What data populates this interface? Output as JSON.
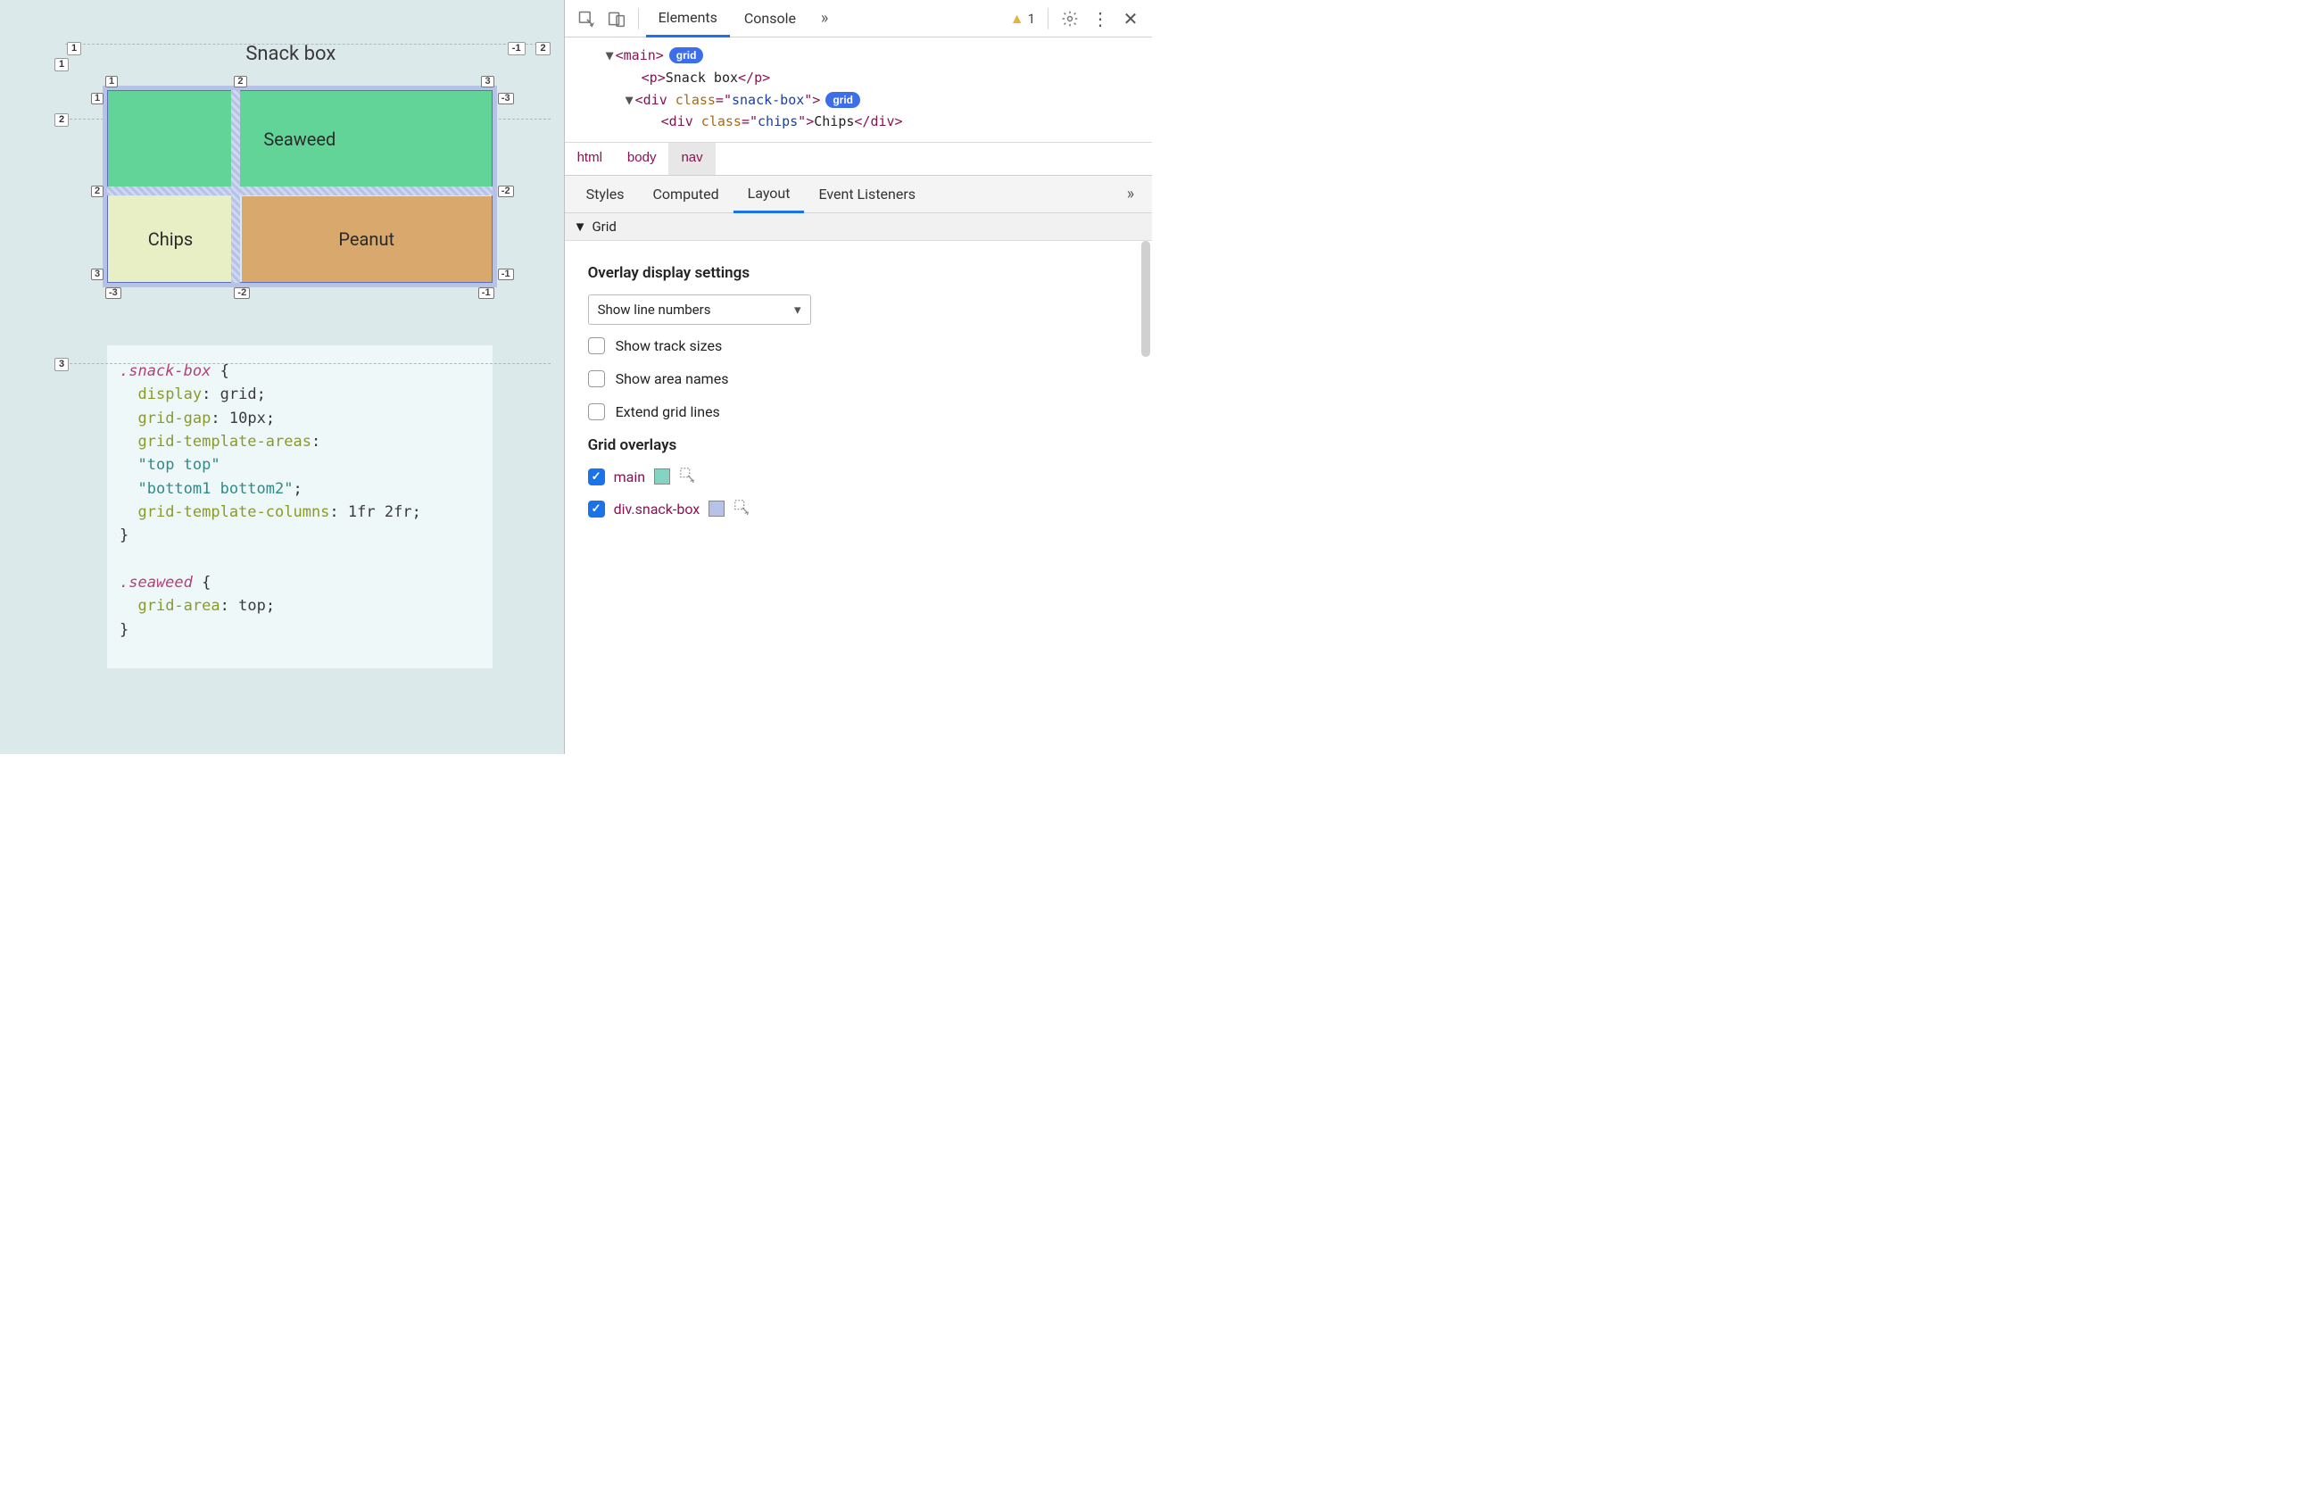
{
  "page": {
    "title": "Snack box",
    "snack_grid": {
      "seaweed": "Seaweed",
      "chips": "Chips",
      "peanut": "Peanut",
      "outer_top_labels": [
        "1",
        "-1",
        "2"
      ],
      "outer_left_labels": [
        "1",
        "2",
        "3"
      ],
      "inner_top_labels": [
        "1",
        "2",
        "3"
      ],
      "inner_top_neg": "-3",
      "inner_mid_labels": [
        "2",
        "-2"
      ],
      "inner_bottom_labels": [
        "3",
        "-1"
      ],
      "inner_bottom_neg": [
        "-3",
        "-2",
        "-1"
      ]
    },
    "code": {
      "sel1": ".snack-box",
      "p1": "display",
      "v1": "grid",
      "p2": "grid-gap",
      "v2": "10px",
      "p3": "grid-template-areas",
      "s1": "\"top top\"",
      "s2": "\"bottom1 bottom2\"",
      "p4": "grid-template-columns",
      "v4": "1fr 2fr",
      "sel2": ".seaweed",
      "p5": "grid-area",
      "v5": "top"
    }
  },
  "devtools": {
    "tabs": [
      "Elements",
      "Console"
    ],
    "warning_count": "1",
    "dom": {
      "l1": {
        "tag": "main",
        "badge": "grid"
      },
      "l2": {
        "tag": "p",
        "text": "Snack box"
      },
      "l3": {
        "tag": "div",
        "attr": "class",
        "val": "snack-box",
        "badge": "grid"
      },
      "l4": {
        "tag": "div",
        "attr": "class",
        "val": "chips",
        "text": "Chips"
      }
    },
    "breadcrumb": [
      "html",
      "body",
      "nav"
    ],
    "panel_tabs": [
      "Styles",
      "Computed",
      "Layout",
      "Event Listeners"
    ],
    "section": "Grid",
    "grid_panel": {
      "heading1": "Overlay display settings",
      "select_value": "Show line numbers",
      "checks": [
        "Show track sizes",
        "Show area names",
        "Extend grid lines"
      ],
      "heading2": "Grid overlays",
      "overlays": [
        {
          "label": "main",
          "swatch": "teal",
          "checked": true
        },
        {
          "label": "div.snack-box",
          "swatch": "lav",
          "checked": true
        }
      ]
    }
  }
}
